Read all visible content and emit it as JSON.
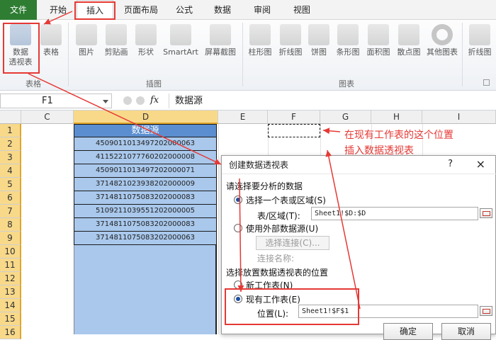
{
  "menu": {
    "tabs": [
      "文件",
      "开始",
      "插入",
      "页面布局",
      "公式",
      "数据",
      "审阅",
      "视图"
    ]
  },
  "ribbon": {
    "buttons": [
      "数据\n透视表",
      "表格",
      "图片",
      "剪贴画",
      "形状",
      "SmartArt",
      "屏幕截图",
      "柱形图",
      "折线图",
      "饼图",
      "条形图",
      "面积图",
      "散点图",
      "其他图表",
      "折线图"
    ],
    "groups": [
      "表格",
      "插图",
      "图表"
    ],
    "pivot_line1": "数据",
    "pivot_line2": "透视表"
  },
  "formula_bar": {
    "name_box": "F1",
    "fx": "fx",
    "content": "数据源"
  },
  "columns": [
    "C",
    "D",
    "E",
    "F",
    "G",
    "H",
    "I"
  ],
  "rows": [
    "1",
    "2",
    "3",
    "4",
    "5",
    "6",
    "7",
    "8",
    "9",
    "10",
    "11",
    "12",
    "13",
    "14",
    "15",
    "16"
  ],
  "cells": {
    "header": "数据源",
    "values": [
      "450901101349720200006​3",
      "411522107776020200000​8",
      "450901101349720200007​1",
      "371482102393820200000​9",
      "371481107508320200008​3",
      "510921103955120200000​5",
      "371481107508320200008​3",
      "371481107508320200006​3"
    ]
  },
  "annotation": {
    "line1": "在现有工作表的这个位置",
    "line2": "插入数据透视表"
  },
  "dialog": {
    "title": "创建数据透视表",
    "help": "?",
    "close": "×",
    "section1": "请选择要分析的数据",
    "opt_table": "选择一个表或区域(S)",
    "range_label": "表/区域(T):",
    "range_value": "Sheet1!$D:$D",
    "opt_external": "使用外部数据源(U)",
    "choose_conn": "选择连接(C)...",
    "conn_name": "连接名称:",
    "section2": "选择放置数据透视表的位置",
    "opt_new": "新工作表(N)",
    "opt_existing": "现有工作表(E)",
    "location_label": "位置(L):",
    "location_value": "Sheet1!$F$1",
    "ok": "确定",
    "cancel": "取消"
  },
  "colors": {
    "accent_red": "#e53935",
    "file_green": "#2e7d32",
    "data_blue": "#a9c8ec",
    "header_blue": "#5b8ed0"
  }
}
